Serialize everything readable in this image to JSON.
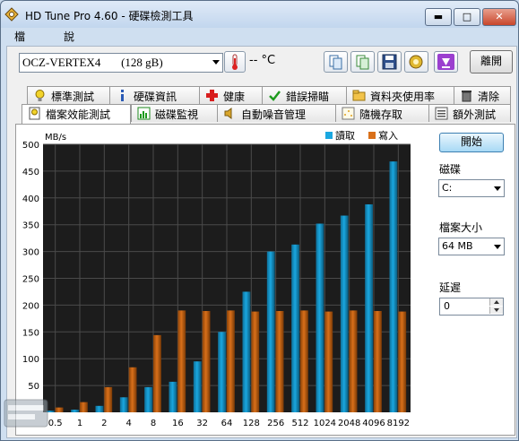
{
  "window": {
    "title": "HD Tune Pro 4.60 - 硬碟檢測工具",
    "minimize_label": "▬",
    "maximize_label": "□",
    "close_label": "✕"
  },
  "menu": {
    "items": [
      "檔案(F)",
      "說明(H)"
    ]
  },
  "toolbar": {
    "device": "OCZ-VERTEX4",
    "device_size": "(128 gB)",
    "temperature": "-- °C",
    "exit_label": "離開",
    "icons": [
      "copy-info-icon",
      "copy-screenshot-icon",
      "save-icon",
      "options-icon",
      "download-icon"
    ]
  },
  "tabs": {
    "row1": [
      {
        "label": "標準測試",
        "icon": "benchmark-icon"
      },
      {
        "label": "硬碟資訊",
        "icon": "info-icon"
      },
      {
        "label": "健康",
        "icon": "health-icon"
      },
      {
        "label": "錯誤掃瞄",
        "icon": "error-scan-icon"
      },
      {
        "label": "資料夾使用率",
        "icon": "folder-icon"
      },
      {
        "label": "清除",
        "icon": "erase-icon"
      }
    ],
    "row2": [
      {
        "label": "檔案效能測試",
        "icon": "file-benchmark-icon",
        "active": true
      },
      {
        "label": "磁碟監視",
        "icon": "disk-monitor-icon"
      },
      {
        "label": "自動噪音管理",
        "icon": "speaker-icon"
      },
      {
        "label": "隨機存取",
        "icon": "random-access-icon"
      },
      {
        "label": "額外測試",
        "icon": "extra-tests-icon"
      }
    ]
  },
  "side": {
    "start_label": "開始",
    "drive_label": "磁碟",
    "drive_value": "C:",
    "file_size_label": "檔案大小",
    "file_size_value": "64 MB",
    "delay_label": "延遲",
    "delay_value": "0"
  },
  "chart_data": {
    "type": "bar",
    "ylabel": "MB/s",
    "ylim": [
      0,
      500
    ],
    "yticks": [
      50,
      100,
      150,
      200,
      250,
      300,
      350,
      400,
      450,
      500
    ],
    "categories": [
      "0.5",
      "1",
      "2",
      "4",
      "8",
      "16",
      "32",
      "64",
      "128",
      "256",
      "512",
      "1024",
      "2048",
      "4096",
      "8192"
    ],
    "series": [
      {
        "name": "讀取",
        "color": "#1aa7e0",
        "values": [
          3,
          5,
          12,
          28,
          47,
          57,
          95,
          150,
          225,
          300,
          313,
          352,
          367,
          388,
          468
        ]
      },
      {
        "name": "寫入",
        "color": "#d9701a",
        "values": [
          9,
          19,
          47,
          84,
          144,
          190,
          189,
          190,
          188,
          189,
          190,
          188,
          190,
          189,
          188
        ]
      }
    ],
    "grid": true,
    "legend": "top-right",
    "background": "#1c1c1c"
  }
}
